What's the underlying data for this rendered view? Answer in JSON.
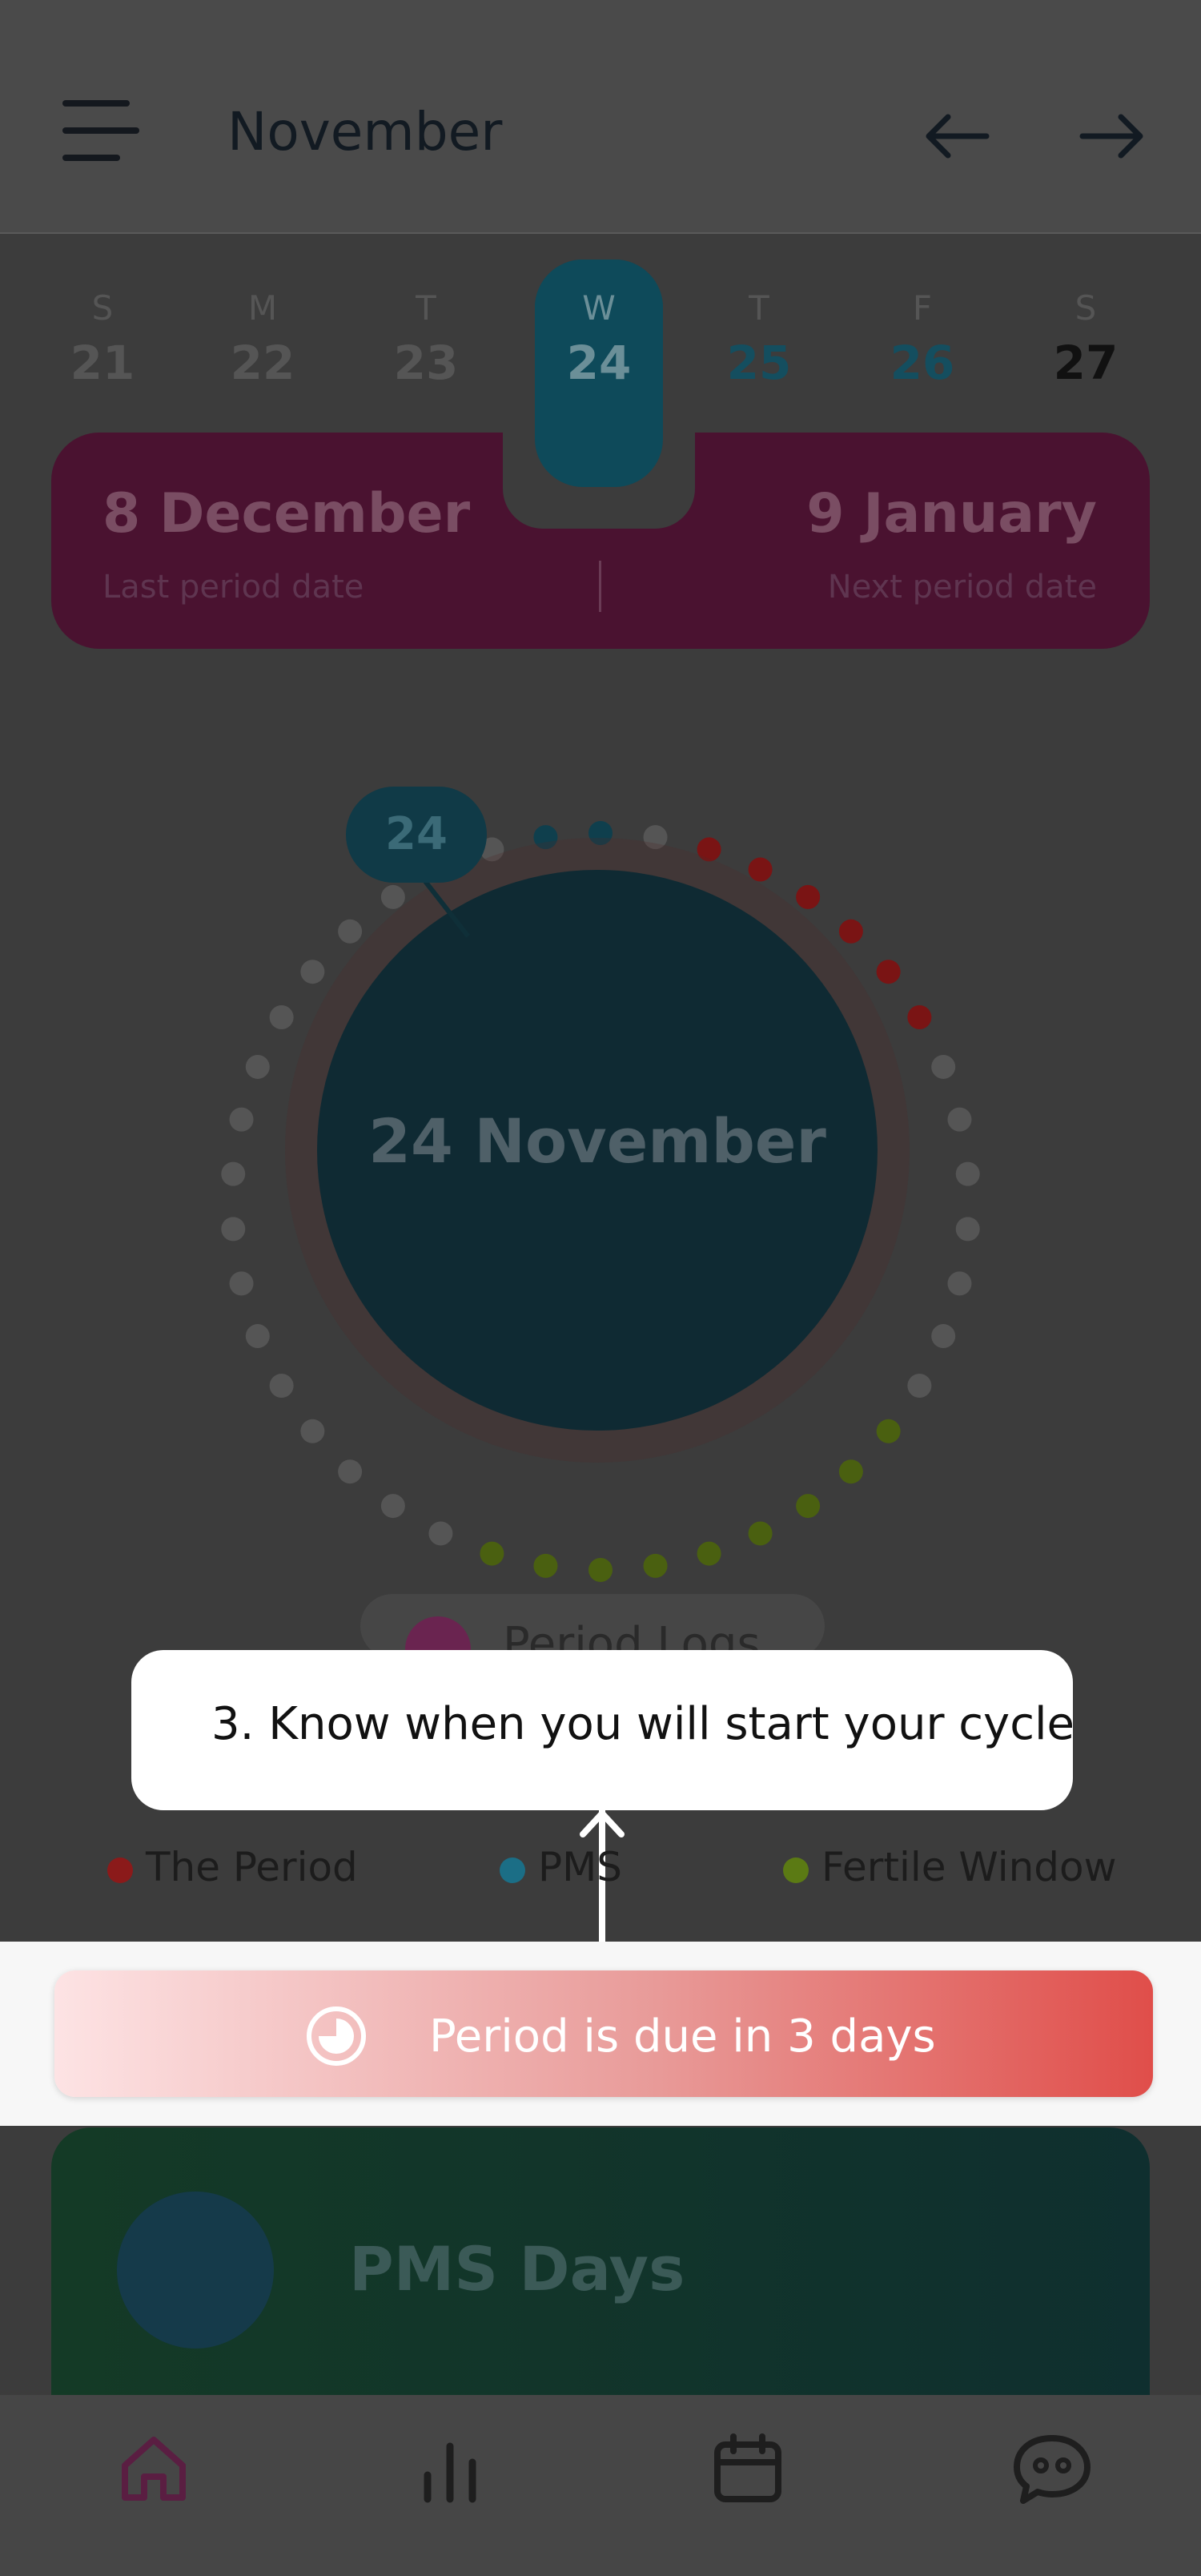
{
  "header": {
    "title": "November"
  },
  "week": {
    "days": [
      {
        "dow": "S",
        "num": "21"
      },
      {
        "dow": "M",
        "num": "22"
      },
      {
        "dow": "T",
        "num": "23"
      },
      {
        "dow": "W",
        "num": "24"
      },
      {
        "dow": "T",
        "num": "25"
      },
      {
        "dow": "F",
        "num": "26"
      },
      {
        "dow": "S",
        "num": "27"
      }
    ]
  },
  "period_card": {
    "last_date": "8 December",
    "last_label": "Last period date",
    "next_date": "9 January",
    "next_label": "Next period date"
  },
  "cycle": {
    "day_badge": "24",
    "center_text": "24 November"
  },
  "logs": {
    "label": "Period Logs"
  },
  "tooltip": {
    "text": "3. Know when you will start your cycle"
  },
  "legend": [
    {
      "label": "The Period",
      "color": "#8b1a1a"
    },
    {
      "label": "PMS",
      "color": "#1b6e86"
    },
    {
      "label": "Fertile Window",
      "color": "#5b7a14"
    }
  ],
  "due_banner": {
    "text": "Period is due in 3 days"
  },
  "pms_card": {
    "title": "PMS Days"
  },
  "colors": {
    "accent_teal": "#0e4a5a",
    "period_red": "#d4544f",
    "fertile_green": "#5b7a14",
    "brand_magenta": "#6a2450"
  },
  "navbar": {
    "items": [
      "home-icon",
      "stats-icon",
      "calendar-icon",
      "chat-icon"
    ]
  }
}
